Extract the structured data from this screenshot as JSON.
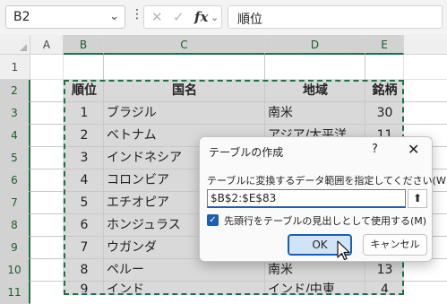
{
  "formula_bar": {
    "name_box": "B2",
    "formula": "順位",
    "cancel_icon": "✕",
    "confirm_icon": "✓",
    "function_icon": "fx"
  },
  "columns": [
    "A",
    "B",
    "C",
    "D",
    "E"
  ],
  "rows": [
    "1",
    "2",
    "3",
    "4",
    "5",
    "6",
    "7",
    "8",
    "9",
    "10",
    "11"
  ],
  "table": {
    "headers": [
      "順位",
      "国名",
      "地域",
      "銘柄"
    ],
    "rows": [
      {
        "rank": "1",
        "country": "ブラジル",
        "region": "南米",
        "brands": "30"
      },
      {
        "rank": "2",
        "country": "ベトナム",
        "region": "アジア/太平洋",
        "brands": "11"
      },
      {
        "rank": "3",
        "country": "インドネシア",
        "region": "",
        "brands": ""
      },
      {
        "rank": "4",
        "country": "コロンビア",
        "region": "",
        "brands": ""
      },
      {
        "rank": "5",
        "country": "エチオピア",
        "region": "",
        "brands": ""
      },
      {
        "rank": "6",
        "country": "ホンジュラス",
        "region": "",
        "brands": ""
      },
      {
        "rank": "7",
        "country": "ウガンダ",
        "region": "",
        "brands": ""
      },
      {
        "rank": "8",
        "country": "ペルー",
        "region": "南米",
        "brands": "13"
      },
      {
        "rank": "9",
        "country": "インド",
        "region": "インド/中東",
        "brands": "4"
      }
    ]
  },
  "dialog": {
    "title": "テーブルの作成",
    "help": "?",
    "close": "✕",
    "prompt": "テーブルに変換するデータ範囲を指定してください(W)",
    "range_value": "$B$2:$E$83",
    "collapse_icon": "⬆",
    "checkbox_label": "先頭行をテーブルの見出しとして使用する(M)",
    "checkbox_checked": true,
    "ok": "OK",
    "cancel": "キャンセル"
  },
  "colors": {
    "accent_green": "#1e7145",
    "ok_blue": "#1a5fb4"
  }
}
